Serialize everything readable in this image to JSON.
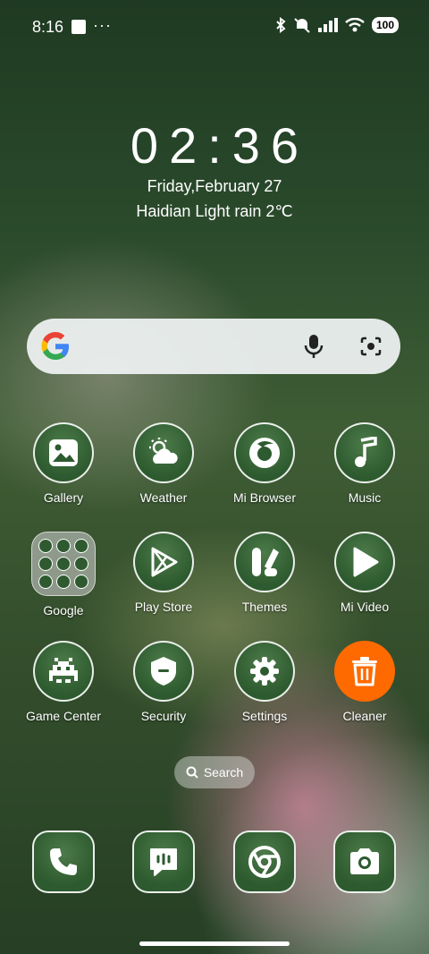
{
  "status_bar": {
    "time": "8:16",
    "more": "···",
    "battery": "100",
    "icons": [
      "bluetooth-icon",
      "mute-icon",
      "signal-icon",
      "wifi-icon",
      "battery-icon"
    ]
  },
  "lock_widget": {
    "clock": "02:36",
    "date": "Friday,February 27",
    "weather": "Haidian Light rain 2℃"
  },
  "search_bar": {
    "icons": [
      "google-logo",
      "mic-icon",
      "lens-icon"
    ]
  },
  "apps": [
    {
      "label": "Gallery",
      "icon": "gallery-icon"
    },
    {
      "label": "Weather",
      "icon": "weather-icon"
    },
    {
      "label": "Mi Browser",
      "icon": "browser-icon"
    },
    {
      "label": "Music",
      "icon": "music-icon"
    },
    {
      "label": "Google",
      "icon": "folder-icon"
    },
    {
      "label": "Play Store",
      "icon": "play-store-icon"
    },
    {
      "label": "Themes",
      "icon": "themes-icon"
    },
    {
      "label": "Mi Video",
      "icon": "video-icon"
    },
    {
      "label": "Game Center",
      "icon": "game-icon"
    },
    {
      "label": "Security",
      "icon": "shield-icon"
    },
    {
      "label": "Settings",
      "icon": "gear-icon"
    },
    {
      "label": "Cleaner",
      "icon": "trash-icon",
      "accent": "#ff6a00"
    }
  ],
  "home_search": {
    "label": "Search"
  },
  "dock": [
    "phone-icon",
    "messages-icon",
    "chrome-icon",
    "camera-icon"
  ]
}
